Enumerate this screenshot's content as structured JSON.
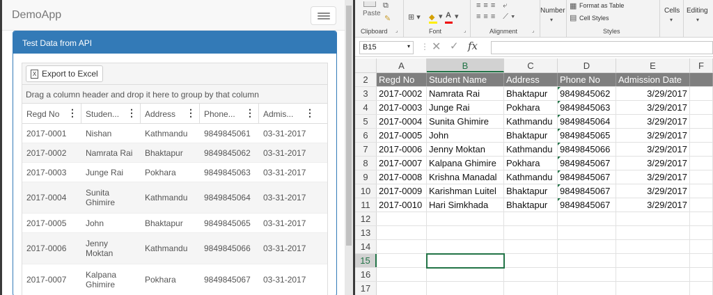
{
  "app": {
    "brand": "DemoApp"
  },
  "panel": {
    "title": "Test Data from API"
  },
  "grid": {
    "export_label": "Export to Excel",
    "group_hint": "Drag a column header and drop it here to group by that column",
    "columns": [
      "Regd No",
      "Studen...",
      "Address",
      "Phone...",
      "Admis..."
    ],
    "rows": [
      [
        "2017-0001",
        "Nishan",
        "Kathmandu",
        "9849845061",
        "03-31-2017"
      ],
      [
        "2017-0002",
        "Namrata Rai",
        "Bhaktapur",
        "9849845062",
        "03-31-2017"
      ],
      [
        "2017-0003",
        "Junge Rai",
        "Pokhara",
        "9849845063",
        "03-31-2017"
      ],
      [
        "2017-0004",
        "Sunita Ghimire",
        "Kathmandu",
        "9849845064",
        "03-31-2017"
      ],
      [
        "2017-0005",
        "John",
        "Bhaktapur",
        "9849845065",
        "03-31-2017"
      ],
      [
        "2017-0006",
        "Jenny Moktan",
        "Kathmandu",
        "9849845066",
        "03-31-2017"
      ],
      [
        "2017-0007",
        "Kalpana Ghimire",
        "Pokhara",
        "9849845067",
        "03-31-2017"
      ]
    ]
  },
  "excel": {
    "ribbon": {
      "paste": "Paste",
      "clipboard": "Clipboard",
      "font": "Font",
      "alignment": "Alignment",
      "number": "Number",
      "format_as_table": "Format as Table",
      "cell_styles": "Cell Styles",
      "styles": "Styles",
      "cells": "Cells",
      "editing": "Editing",
      "fx": "fx"
    },
    "name_box": "B15",
    "columns": [
      "A",
      "B",
      "C",
      "D",
      "E",
      "F"
    ],
    "selected_column": "B",
    "header_row": {
      "num": "2",
      "cells": [
        "Regd No",
        "Student Name",
        "Address",
        "Phone No",
        "Admission Date"
      ]
    },
    "rows": [
      {
        "num": "3",
        "cells": [
          "2017-0002",
          "Namrata Rai",
          "Bhaktapur",
          "9849845062",
          "3/29/2017"
        ]
      },
      {
        "num": "4",
        "cells": [
          "2017-0003",
          "Junge Rai",
          "Pokhara",
          "9849845063",
          "3/29/2017"
        ]
      },
      {
        "num": "5",
        "cells": [
          "2017-0004",
          "Sunita Ghimire",
          "Kathmandu",
          "9849845064",
          "3/29/2017"
        ]
      },
      {
        "num": "6",
        "cells": [
          "2017-0005",
          "John",
          "Bhaktapur",
          "9849845065",
          "3/29/2017"
        ]
      },
      {
        "num": "7",
        "cells": [
          "2017-0006",
          "Jenny Moktan",
          "Kathmandu",
          "9849845066",
          "3/29/2017"
        ]
      },
      {
        "num": "8",
        "cells": [
          "2017-0007",
          "Kalpana Ghimire",
          "Pokhara",
          "9849845067",
          "3/29/2017"
        ]
      },
      {
        "num": "9",
        "cells": [
          "2017-0008",
          "Krishna Manadal",
          "Kathmandu",
          "9849845067",
          "3/29/2017"
        ]
      },
      {
        "num": "10",
        "cells": [
          "2017-0009",
          "Karishman Luitel",
          "Bhaktapur",
          "9849845067",
          "3/29/2017"
        ]
      },
      {
        "num": "11",
        "cells": [
          "2017-0010",
          "Hari Simkhada",
          "Bhaktapur",
          "9849845067",
          "3/29/2017"
        ]
      }
    ],
    "empty_rows": [
      "12",
      "13",
      "14",
      "15",
      "16",
      "17"
    ],
    "selected_row": "15",
    "accent": "#217346"
  }
}
